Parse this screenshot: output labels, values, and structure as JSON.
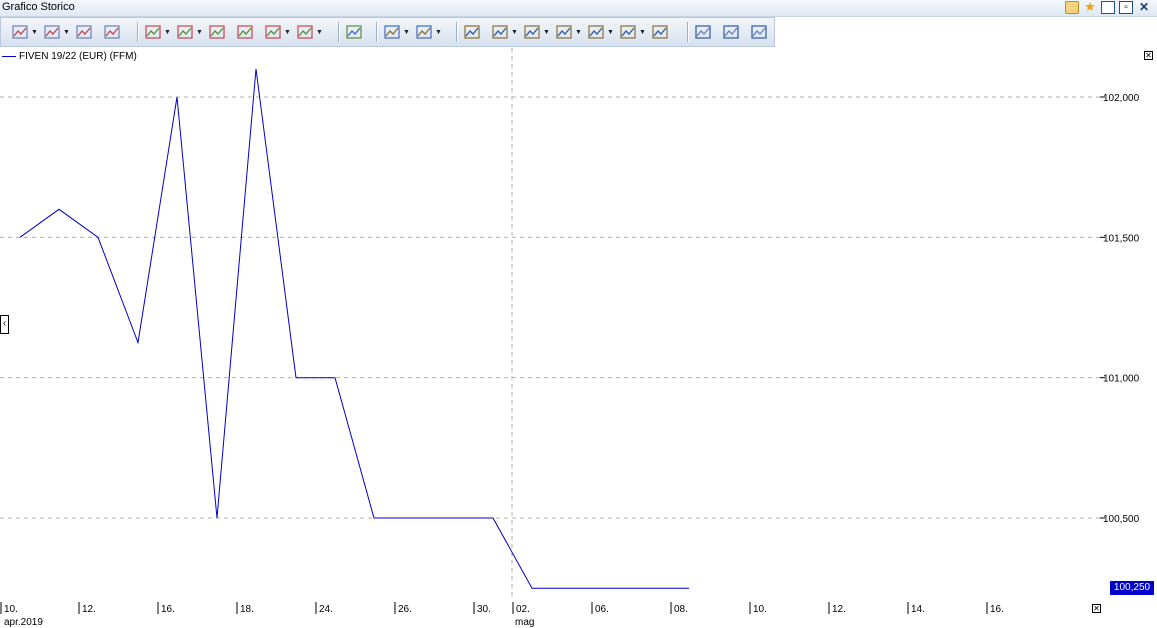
{
  "window": {
    "title": "Grafico Storico",
    "controls": [
      "notes-icon",
      "favorite-star-icon",
      "maximize-icon",
      "restore-icon",
      "close-icon"
    ]
  },
  "toolbar": {
    "groups": [
      [
        "chart-type-icon",
        "indicators-icon",
        "compare-icon",
        "studies-icon"
      ],
      [
        "drawing-line-icon",
        "trend-icon",
        "volume-bars-icon",
        "pattern-icon",
        "candlestick-icon",
        "period-icon"
      ],
      [
        "auto-scale-icon"
      ],
      [
        "line-style-icon",
        "grid-icon"
      ],
      [
        "delete-drawings-icon",
        "zoom-icon",
        "pointer-icon",
        "pencil-icon",
        "color-fill-icon",
        "settings-icon",
        "clipboard-icon"
      ],
      [
        "copy-icon",
        "print-icon",
        "export-icon"
      ]
    ]
  },
  "legend": {
    "series_label": "FIVEN 19/22 (EUR) (FFM)",
    "color": "#0000cc"
  },
  "last_value_badge": "100,250",
  "colors": {
    "line": "#0000cc",
    "grid": "#b0b0b0",
    "badge_bg": "#0000cc"
  },
  "chart_data": {
    "type": "line",
    "series": [
      {
        "name": "FIVEN 19/22 (EUR) (FFM)",
        "x": [
          "2019-04-10",
          "2019-04-11",
          "2019-04-12",
          "2019-04-15",
          "2019-04-16",
          "2019-04-17",
          "2019-04-18",
          "2019-04-23",
          "2019-04-24",
          "2019-04-25",
          "2019-04-26",
          "2019-04-29",
          "2019-04-30",
          "2019-05-02",
          "2019-05-03",
          "2019-05-06",
          "2019-05-07",
          "2019-05-08",
          "2019-05-09"
        ],
        "values": [
          101.5,
          101.6,
          101.5,
          101.125,
          102.0,
          100.5,
          102.1,
          101.0,
          101.0,
          100.5,
          100.5,
          100.5,
          100.5,
          100.25,
          100.25,
          100.25,
          100.25,
          100.25,
          100.25
        ]
      }
    ],
    "ylim": [
      100.0,
      102.2
    ],
    "yticks": [
      "102,000",
      "101,500",
      "101,000",
      "100,500"
    ],
    "ytick_values": [
      102.0,
      101.5,
      101.0,
      100.5
    ],
    "xticks": [
      "10.",
      "12.",
      "16.",
      "18.",
      "24.",
      "26.",
      "30.",
      "02.",
      "06.",
      "08.",
      "10.",
      "12.",
      "14.",
      "16."
    ],
    "xtick_sublabels": {
      "apr": "apr.2019",
      "may": "mag"
    },
    "grid": "horizontal-dashed",
    "legend": "top-left"
  }
}
